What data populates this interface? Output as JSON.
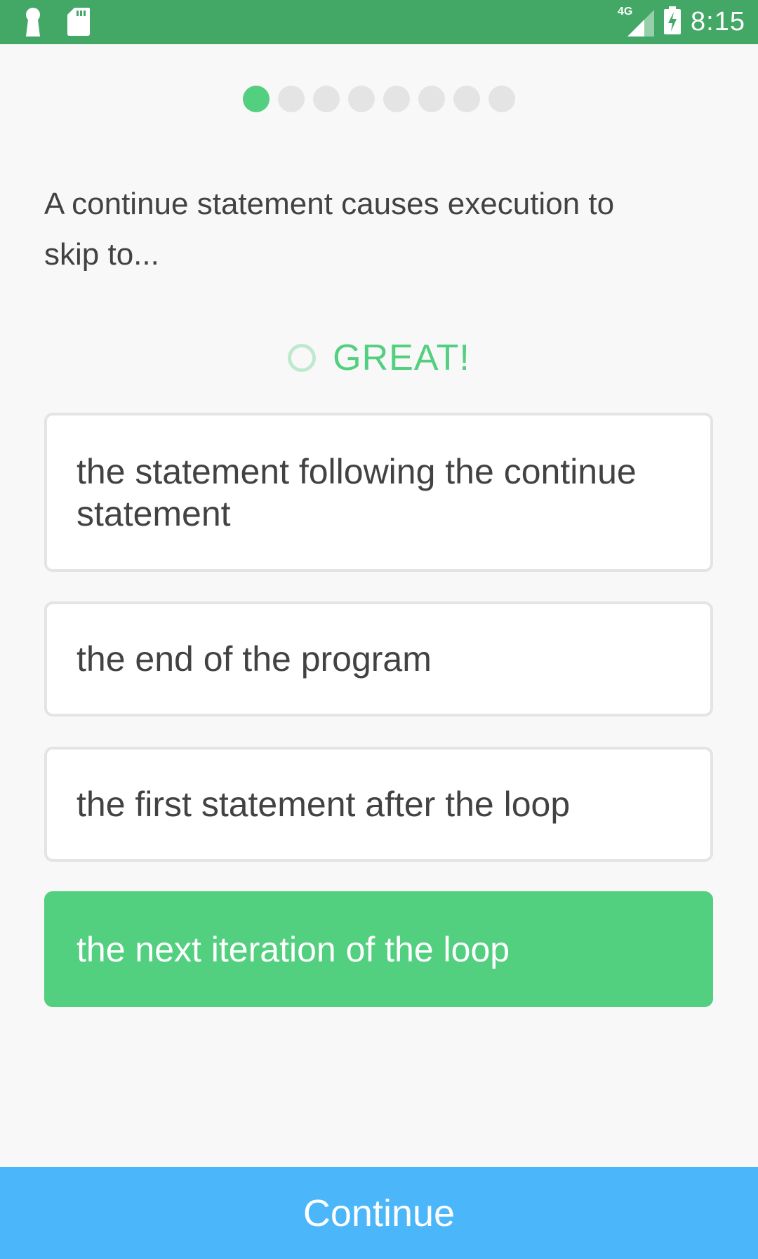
{
  "status_bar": {
    "time": "8:15",
    "network": "4G",
    "icons": [
      "keyhole-icon",
      "sd-card-icon",
      "signal-icon",
      "battery-charging-icon"
    ]
  },
  "progress": {
    "total": 8,
    "current": 1
  },
  "question": {
    "text": "A continue statement causes execution to skip to..."
  },
  "feedback": {
    "text": "GREAT!",
    "icon": "circle-outline-icon"
  },
  "options": [
    {
      "label": "the statement following the continue statement",
      "correct": false
    },
    {
      "label": "the end of the program",
      "correct": false
    },
    {
      "label": "the first statement after the loop",
      "correct": false
    },
    {
      "label": "the next iteration of the loop",
      "correct": true
    }
  ],
  "continue_button": {
    "label": "Continue"
  },
  "colors": {
    "status_bar": "#43a866",
    "accent_green": "#53cf80",
    "continue_blue": "#4bb6fa",
    "dot_inactive": "#e4e4e4",
    "text": "#424242"
  }
}
